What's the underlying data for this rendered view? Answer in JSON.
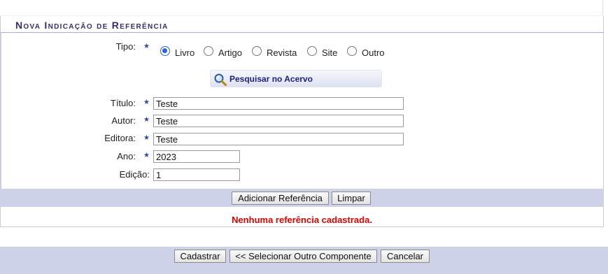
{
  "panel": {
    "title": "Nova Indicação de Referência"
  },
  "form": {
    "tipo_label": "Tipo:",
    "tipo_options": [
      "Livro",
      "Artigo",
      "Revista",
      "Site",
      "Outro"
    ],
    "tipo_selected": "Livro",
    "search_button": "Pesquisar no Acervo",
    "titulo_label": "Título:",
    "titulo_value": "Teste",
    "autor_label": "Autor:",
    "autor_value": "Teste",
    "editora_label": "Editora:",
    "editora_value": "Teste",
    "ano_label": "Ano:",
    "ano_value": "2023",
    "edicao_label": "Edição:",
    "edicao_value": "1",
    "required_icon": "star-icon"
  },
  "actions": {
    "add_label": "Adicionar Referência",
    "clear_label": "Limpar"
  },
  "message": "Nenhuma referência cadastrada.",
  "footer": {
    "submit_label": "Cadastrar",
    "back_label": "<< Selecionar Outro Componente",
    "cancel_label": "Cancelar"
  },
  "colors": {
    "title_text": "#3a2c6b",
    "bar_background": "#cdd2e8",
    "error_text": "#e00000",
    "radio_checked": "#2a63e8"
  }
}
